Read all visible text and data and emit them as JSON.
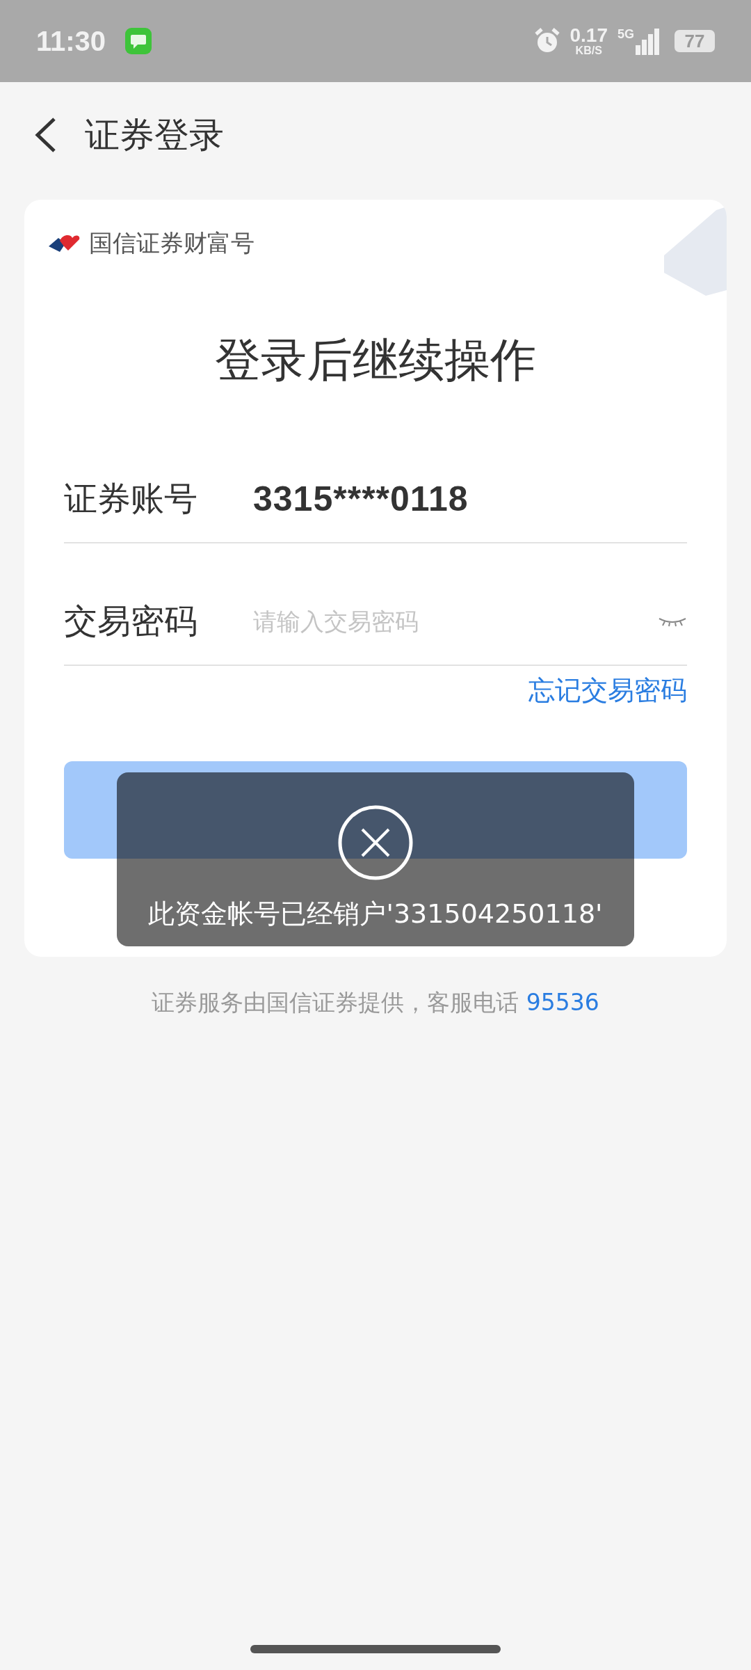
{
  "status_bar": {
    "time": "11:30",
    "speed": "0.17",
    "speed_unit": "KB/S",
    "network": "5G",
    "battery": "77"
  },
  "header": {
    "title": "证券登录"
  },
  "card": {
    "brand": "国信证券财富号",
    "heading": "登录后继续操作",
    "fields": [
      {
        "label": "证券账号",
        "value": "3315****0118"
      },
      {
        "label": "交易密码",
        "placeholder": "请输入交易密码"
      }
    ],
    "forgot_link": "忘记交易密码"
  },
  "toast": {
    "message": "此资金帐号已经销户'331504250118'"
  },
  "footer": {
    "text": "证券服务由国信证券提供，客服电话",
    "phone": "95536"
  }
}
